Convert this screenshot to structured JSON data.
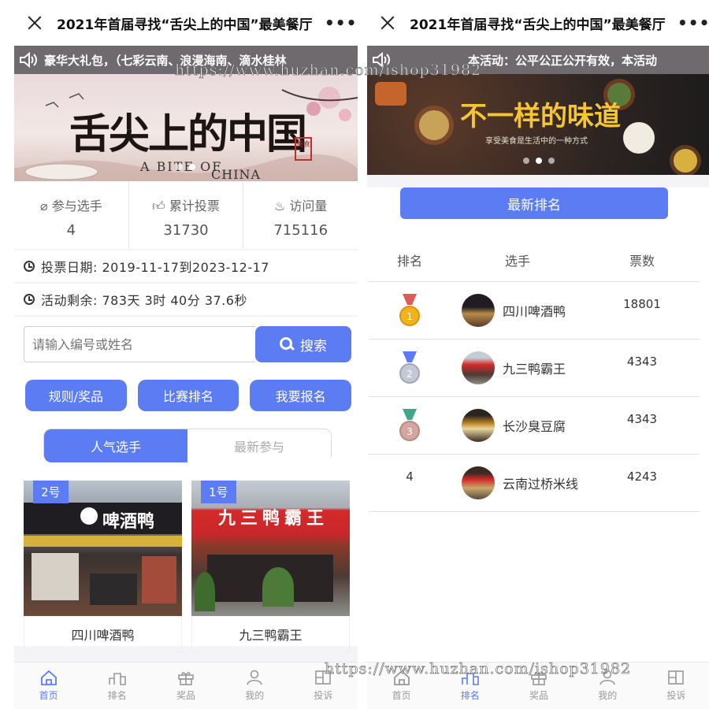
{
  "left": {
    "title": "2021年首届寻找“舌尖上的中国”最美餐厅",
    "more": "•••",
    "notice": "豪华大礼包，（七彩云南、浪漫海南、滴水桂林",
    "banner": {
      "title": "舌尖上的中国",
      "en_a": "A BITE OF",
      "en_b": "CHINA",
      "seal": "美食"
    },
    "stats": [
      {
        "label": "参与选手",
        "value": "4",
        "icon": "paperclip-icon"
      },
      {
        "label": "累计投票",
        "value": "31730",
        "icon": "thumbs-up-icon"
      },
      {
        "label": "访问量",
        "value": "715116",
        "icon": "flame-icon"
      }
    ],
    "vote_date": "投票日期: 2019-11-17到2023-12-17",
    "remaining": "活动剩余: 783天 3时 40分 37.6秒",
    "search": {
      "placeholder": "请输入编号或姓名",
      "button": "搜索"
    },
    "buttons": {
      "rules": "规则/奖品",
      "ranking": "比赛排名",
      "signup": "我要报名"
    },
    "tabs": {
      "popular": "人气选手",
      "latest": "最新参与"
    },
    "cards": [
      {
        "badge": "2号",
        "name": "四川啤酒鸭",
        "sign": "啤酒鸭"
      },
      {
        "badge": "1号",
        "name": "九三鸭霸王",
        "sign": "九三鸭霸王"
      }
    ]
  },
  "right": {
    "title": "2021年首届寻找“舌尖上的中国”最美餐厅",
    "notice": "本活动：公平公正公开有效，本活动",
    "banner": {
      "title": "不一样的味道",
      "sub": "享受美食是生活中的一种方式"
    },
    "rank_button": "最新排名",
    "headers": {
      "rank": "排名",
      "player": "选手",
      "votes": "票数"
    },
    "rows": [
      {
        "rank": "",
        "medal": "gold",
        "name": "四川啤酒鸭",
        "votes": "18801"
      },
      {
        "rank": "",
        "medal": "silver",
        "name": "九三鸭霸王",
        "votes": "4343"
      },
      {
        "rank": "",
        "medal": "bronze",
        "name": "长沙臭豆腐",
        "votes": "4343"
      },
      {
        "rank": "4",
        "medal": "",
        "name": "云南过桥米线",
        "votes": "4243"
      }
    ]
  },
  "tabbar": {
    "home": "首页",
    "ranking": "排名",
    "prizes": "奖品",
    "mine": "我的",
    "report": "投诉"
  },
  "watermark": "https://www.huzhan.com/ishop31982",
  "colors": {
    "accent": "#5b7cf2",
    "notice_bg": "#6f6a6e"
  }
}
